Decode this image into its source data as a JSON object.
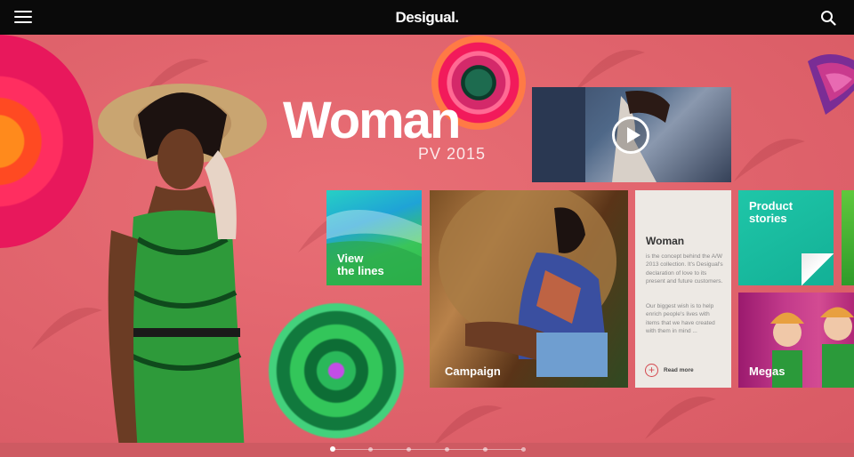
{
  "header": {
    "logo": "Desigual.",
    "menu_icon": "hamburger-menu-icon",
    "search_icon": "magnifier-search-icon"
  },
  "hero": {
    "title": "Woman",
    "subtitle": "PV 2015"
  },
  "tiles": {
    "lines_label_1": "View",
    "lines_label_2": "the lines",
    "campaign_label": "Campaign",
    "woman_heading": "Woman",
    "woman_para_1": "is the concept behind the A/W 2013 collection. It's Desigual's declaration of love to its present and future customers.",
    "woman_para_2": "Our biggest wish is to help enrich people's lives with items that we have created with them in mind ...",
    "read_more": "Read more",
    "product_label_1": "Product",
    "product_label_2": "stories",
    "megas_label": "Megas"
  },
  "pager": {
    "count": 6,
    "active": 0
  },
  "colors": {
    "background": "#e0646c",
    "topbar": "#0a0a0a",
    "accent": "#d4484f",
    "teal_tile": "#1fc6a8"
  }
}
